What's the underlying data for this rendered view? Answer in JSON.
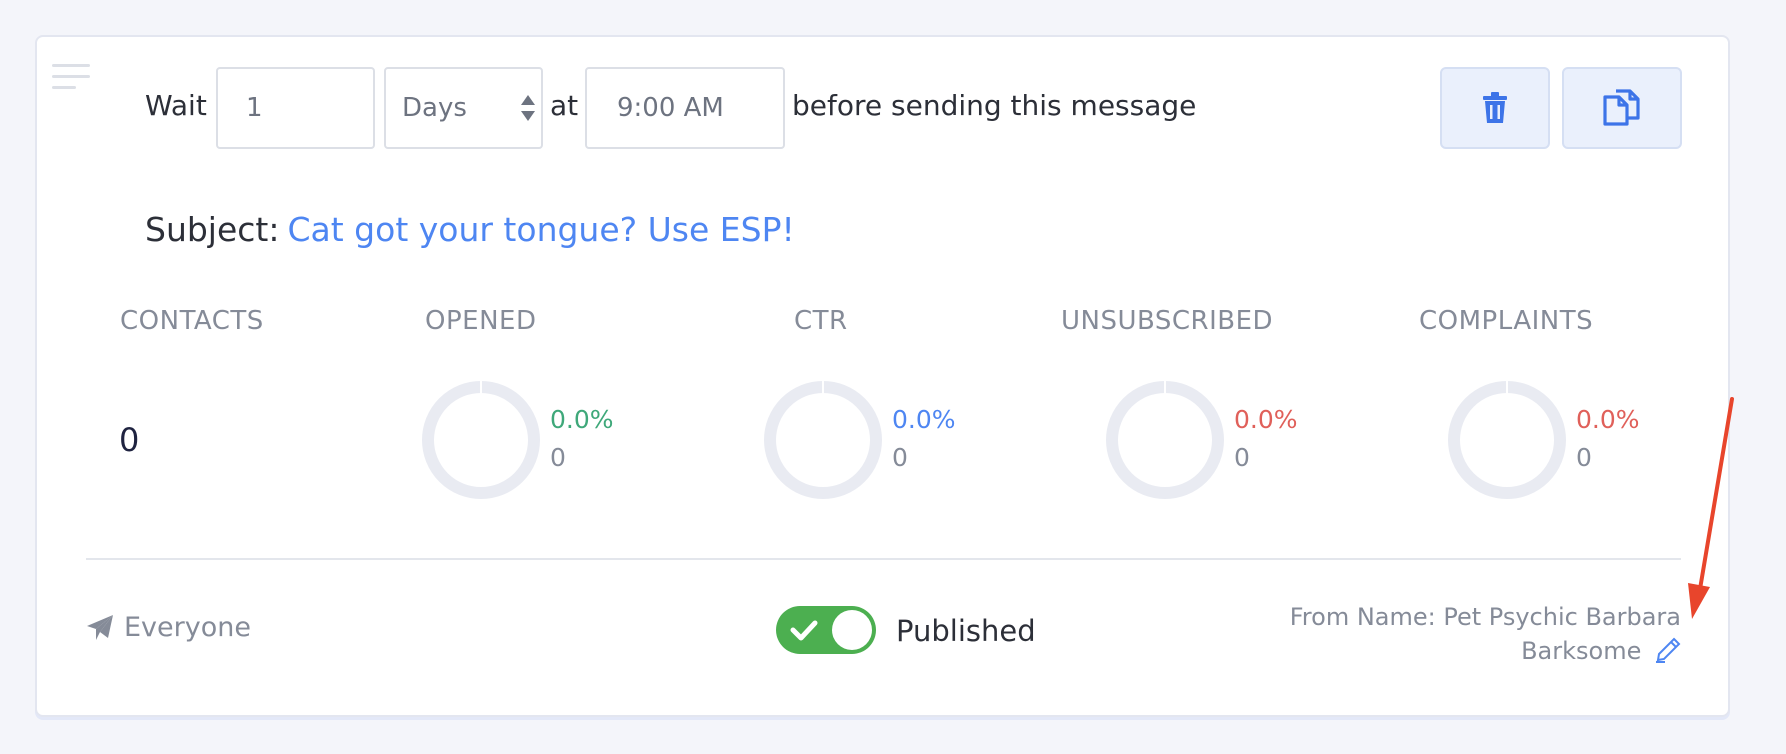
{
  "schedule": {
    "wait_label": "Wait",
    "amount_value": "1",
    "unit_selected": "Days",
    "at_label": "at",
    "time_value": "9:00 AM",
    "suffix_label": "before sending this message"
  },
  "actions": {
    "delete_icon": "trash-icon",
    "copy_icon": "copy-icon"
  },
  "subject": {
    "label": "Subject:",
    "value": "Cat got your tongue? Use ESP!"
  },
  "stats": {
    "contacts": {
      "header": "CONTACTS",
      "value": "0"
    },
    "opened": {
      "header": "OPENED",
      "percent": "0.0%",
      "count": "0",
      "color": "#3fa87a",
      "fraction": 0
    },
    "ctr": {
      "header": "CTR",
      "percent": "0.0%",
      "count": "0",
      "color": "#4e86f2",
      "fraction": 0
    },
    "unsubscribed": {
      "header": "UNSUBSCRIBED",
      "percent": "0.0%",
      "count": "0",
      "color": "#e0605a",
      "fraction": 0
    },
    "complaints": {
      "header": "COMPLAINTS",
      "percent": "0.0%",
      "count": "0",
      "color": "#e0605a",
      "fraction": 0
    }
  },
  "footer": {
    "audience_label": "Everyone",
    "audience_icon": "paper-plane-icon",
    "published": true,
    "published_label": "Published",
    "from_name_label": "From Name: Pet Psychic Barbara Barksome",
    "edit_icon": "pencil-icon"
  },
  "colors": {
    "accent": "#4e86f2",
    "toggle_on": "#4caf50",
    "annotation": "#e8452c"
  }
}
